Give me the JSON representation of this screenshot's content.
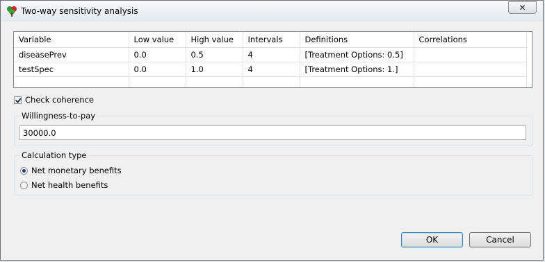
{
  "window": {
    "title": "Two-way sensitivity analysis",
    "close_symbol": "✕"
  },
  "table": {
    "columns": [
      "Variable",
      "Low value",
      "High value",
      "Intervals",
      "Definitions",
      "Correlations"
    ],
    "rows": [
      [
        "diseasePrev",
        "0.0",
        "0.5",
        "4",
        "[Treatment Options: 0.5]",
        ""
      ],
      [
        "testSpec",
        "0.0",
        "1.0",
        "4",
        "[Treatment Options: 1.]",
        ""
      ]
    ]
  },
  "check_coherence": {
    "label": "Check coherence",
    "checked": true
  },
  "willingness": {
    "label": "Willingness-to-pay",
    "value": "30000.0"
  },
  "calculation": {
    "label": "Calculation type",
    "options": [
      {
        "label": "Net monetary benefits",
        "selected": true
      },
      {
        "label": "Net health benefits",
        "selected": false
      }
    ]
  },
  "buttons": {
    "ok": "OK",
    "cancel": "Cancel"
  },
  "colors": {
    "titlebar_top": "#f7f9fb",
    "dialog_bg": "#f0f0f0",
    "primary_border": "#3c7fb1"
  },
  "icons": {
    "app": "treeage-app-icon",
    "close": "close-icon"
  }
}
